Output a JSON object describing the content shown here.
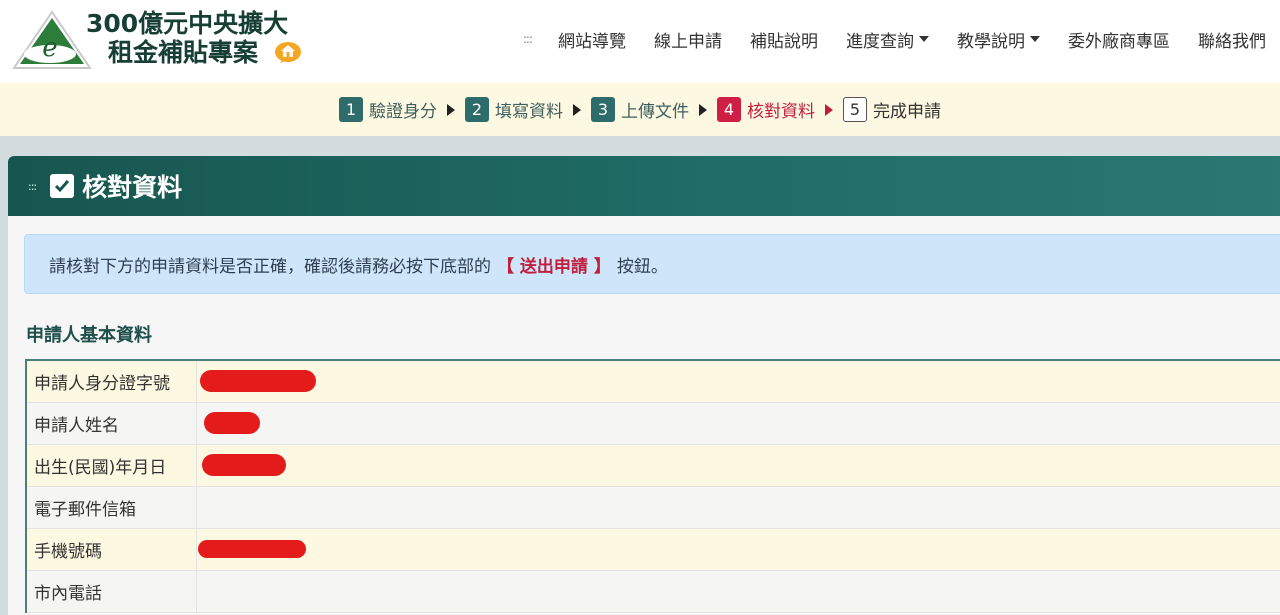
{
  "header": {
    "logo_line1": "300億元中央擴大",
    "logo_line2": "租金補貼專案",
    "nav_dots": ":::",
    "nav": [
      {
        "label": "網站導覽",
        "dropdown": false
      },
      {
        "label": "線上申請",
        "dropdown": false
      },
      {
        "label": "補貼說明",
        "dropdown": false
      },
      {
        "label": "進度查詢",
        "dropdown": true
      },
      {
        "label": "教學說明",
        "dropdown": true
      },
      {
        "label": "委外廠商專區",
        "dropdown": false
      },
      {
        "label": "聯絡我們",
        "dropdown": false
      }
    ]
  },
  "steps": [
    {
      "num": "1",
      "label": "驗證身分",
      "state": "done"
    },
    {
      "num": "2",
      "label": "填寫資料",
      "state": "done"
    },
    {
      "num": "3",
      "label": "上傳文件",
      "state": "done"
    },
    {
      "num": "4",
      "label": "核對資料",
      "state": "active"
    },
    {
      "num": "5",
      "label": "完成申請",
      "state": "pending"
    }
  ],
  "panel": {
    "dots": ":::",
    "title": "核對資料"
  },
  "alert": {
    "text_before": "請核對下方的申請資料是否正確，確認後請務必按下底部的",
    "highlight": "【 送出申請 】",
    "text_after": "按鈕。"
  },
  "section": {
    "title": "申請人基本資料",
    "rows": [
      {
        "label": "申請人身分證字號",
        "redacted": true
      },
      {
        "label": "申請人姓名",
        "redacted": true
      },
      {
        "label": "出生(民國)年月日",
        "redacted": true
      },
      {
        "label": "電子郵件信箱",
        "redacted": false
      },
      {
        "label": "手機號碼",
        "redacted": true
      },
      {
        "label": "市內電話",
        "redacted": false
      }
    ]
  },
  "colors": {
    "brand_teal": "#17564f",
    "step_done": "#2e6b6b",
    "step_active": "#d01f44",
    "alert_bg": "#cfe6fa",
    "redaction": "#e41b1b"
  }
}
